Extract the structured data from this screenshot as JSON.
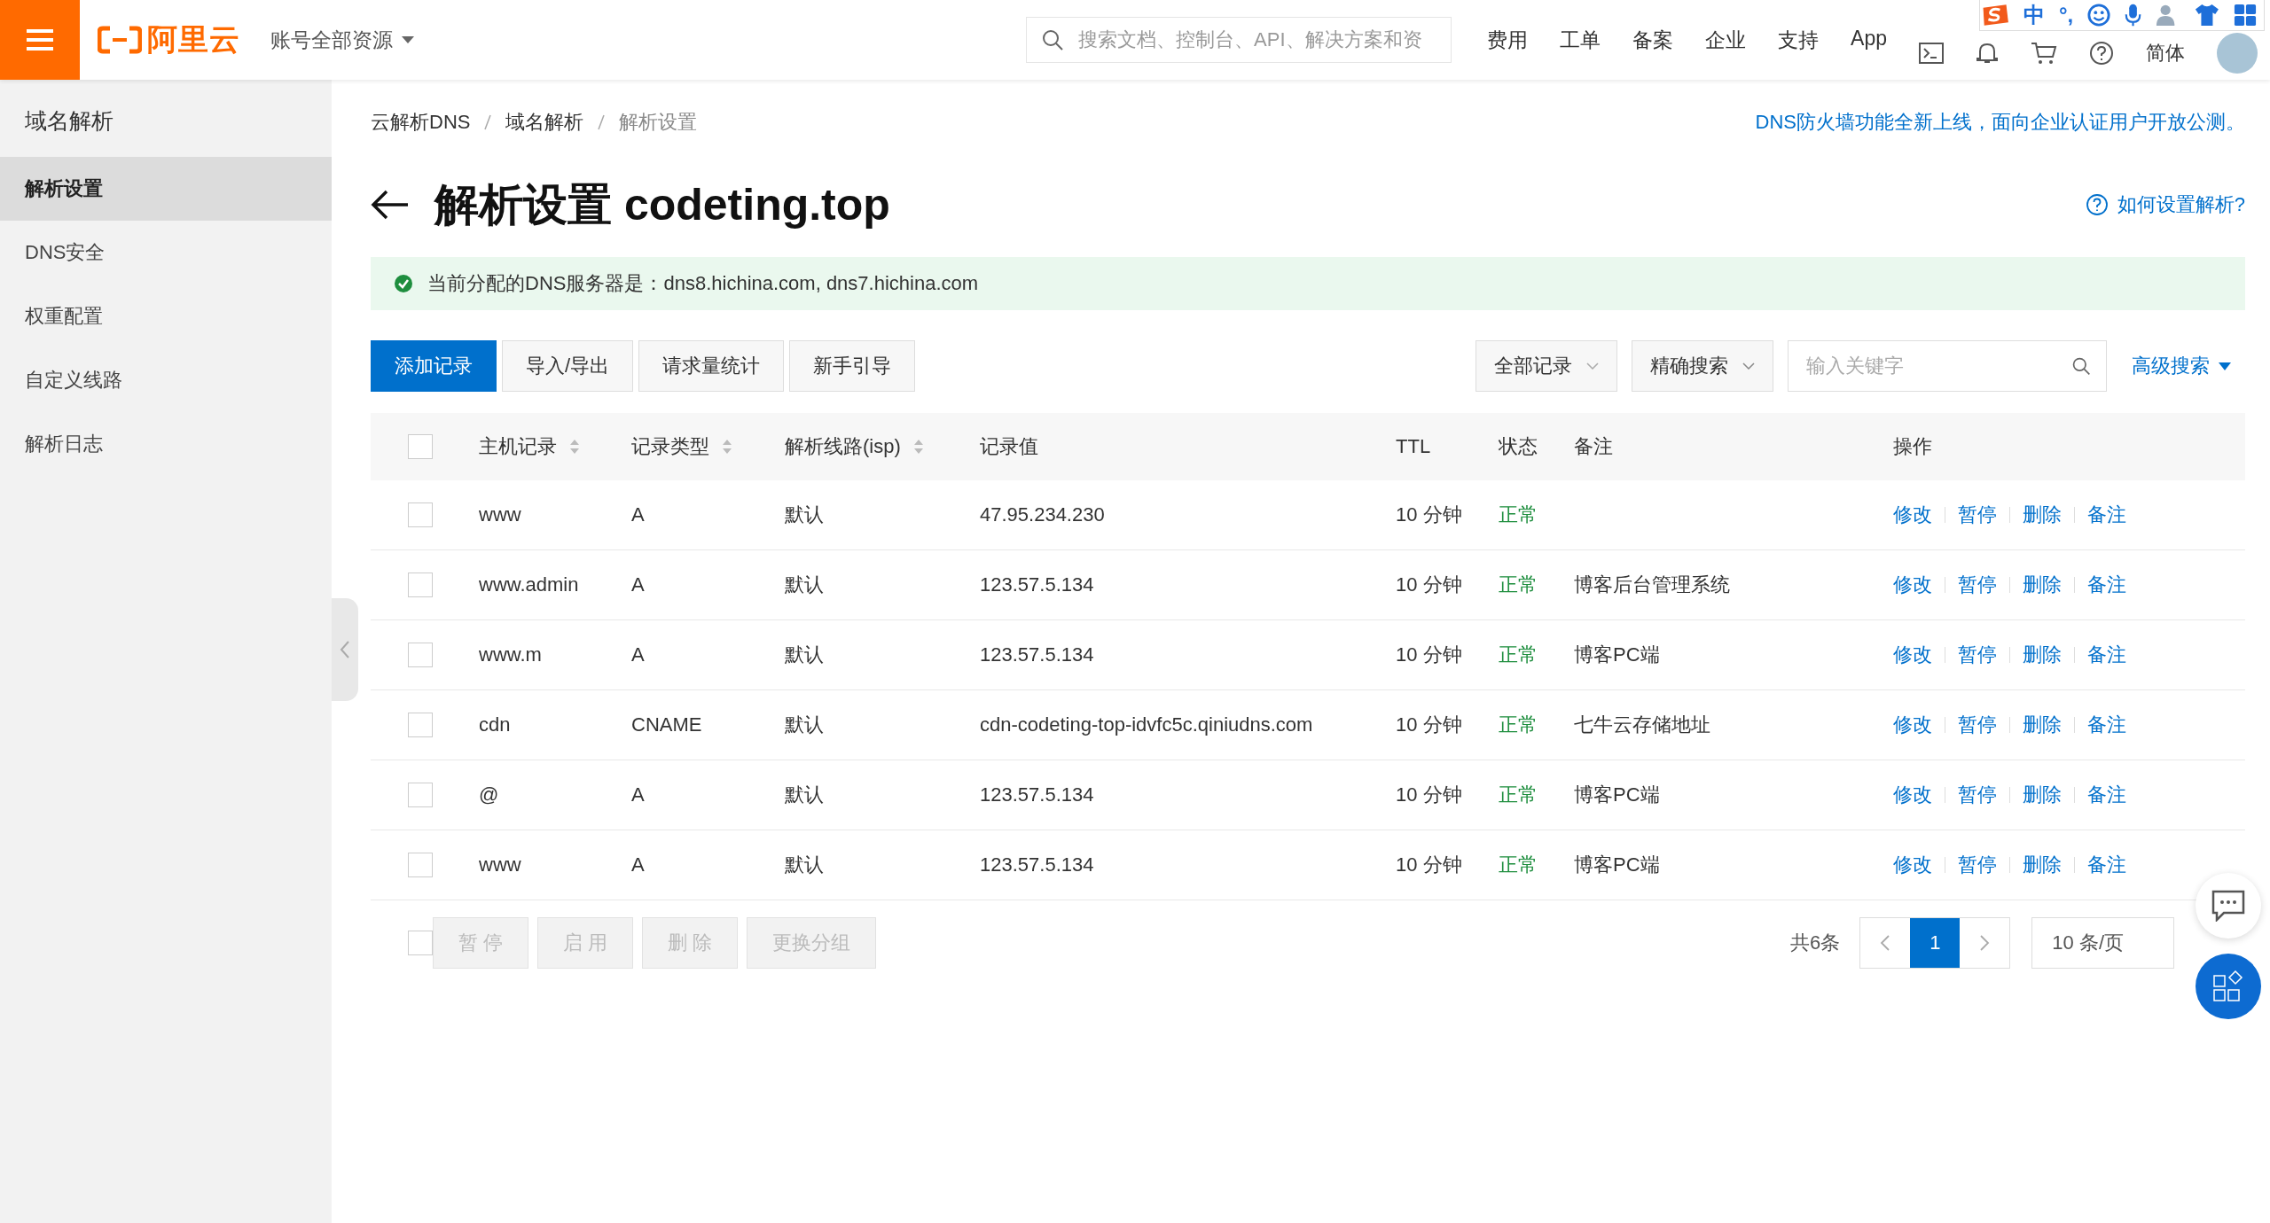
{
  "topbar": {
    "logo": "阿里云",
    "account_menu": "账号全部资源",
    "search": {
      "placeholder": "搜索文档、控制台、API、解决方案和资"
    },
    "nav": [
      "费用",
      "工单",
      "备案",
      "企业",
      "支持",
      "App"
    ],
    "language": "简体"
  },
  "ime_toolbar": {
    "mode": "中",
    "punctuation": "°,"
  },
  "sidebar": {
    "title": "域名解析",
    "items": [
      {
        "label": "解析设置",
        "selected": true
      },
      {
        "label": "DNS安全",
        "selected": false
      },
      {
        "label": "权重配置",
        "selected": false
      },
      {
        "label": "自定义线路",
        "selected": false
      },
      {
        "label": "解析日志",
        "selected": false
      }
    ]
  },
  "breadcrumb": [
    "云解析DNS",
    "域名解析",
    "解析设置"
  ],
  "notice_link": "DNS防火墙功能全新上线，面向企业认证用户开放公测。",
  "title": "解析设置 codeting.top",
  "help_link": "如何设置解析?",
  "alert": "当前分配的DNS服务器是：dns8.hichina.com, dns7.hichina.com",
  "toolbar": {
    "buttons": [
      {
        "label": "添加记录",
        "primary": true
      },
      {
        "label": "导入/导出",
        "primary": false
      },
      {
        "label": "请求量统计",
        "primary": false
      },
      {
        "label": "新手引导",
        "primary": false
      }
    ],
    "filter": "全部记录",
    "search_mode": "精确搜索",
    "search": {
      "placeholder": "输入关键字"
    },
    "advanced": "高级搜索"
  },
  "table": {
    "select_all": {
      "checked": false
    },
    "columns": [
      {
        "label": "主机记录",
        "sortable": true
      },
      {
        "label": "记录类型",
        "sortable": true
      },
      {
        "label": "解析线路(isp)",
        "sortable": true
      },
      {
        "label": "记录值",
        "sortable": false
      },
      {
        "label": "TTL",
        "sortable": false
      },
      {
        "label": "状态",
        "sortable": false
      },
      {
        "label": "备注",
        "sortable": false
      },
      {
        "label": "操作",
        "sortable": false
      }
    ],
    "rows": [
      {
        "checked": false,
        "host": "www",
        "type": "A",
        "line": "默认",
        "value": "47.95.234.230",
        "ttl": "10 分钟",
        "status": "正常",
        "remark": "",
        "actions": [
          "修改",
          "暂停",
          "删除",
          "备注"
        ]
      },
      {
        "checked": false,
        "host": "www.admin",
        "type": "A",
        "line": "默认",
        "value": "123.57.5.134",
        "ttl": "10 分钟",
        "status": "正常",
        "remark": "博客后台管理系统",
        "actions": [
          "修改",
          "暂停",
          "删除",
          "备注"
        ]
      },
      {
        "checked": false,
        "host": "www.m",
        "type": "A",
        "line": "默认",
        "value": "123.57.5.134",
        "ttl": "10 分钟",
        "status": "正常",
        "remark": "博客PC端",
        "actions": [
          "修改",
          "暂停",
          "删除",
          "备注"
        ]
      },
      {
        "checked": false,
        "host": "cdn",
        "type": "CNAME",
        "line": "默认",
        "value": "cdn-codeting-top-idvfc5c.qiniudns.com",
        "ttl": "10 分钟",
        "status": "正常",
        "remark": "七牛云存储地址",
        "actions": [
          "修改",
          "暂停",
          "删除",
          "备注"
        ]
      },
      {
        "checked": false,
        "host": "@",
        "type": "A",
        "line": "默认",
        "value": "123.57.5.134",
        "ttl": "10 分钟",
        "status": "正常",
        "remark": "博客PC端",
        "actions": [
          "修改",
          "暂停",
          "删除",
          "备注"
        ]
      },
      {
        "checked": false,
        "host": "www",
        "type": "A",
        "line": "默认",
        "value": "123.57.5.134",
        "ttl": "10 分钟",
        "status": "正常",
        "remark": "博客PC端",
        "actions": [
          "修改",
          "暂停",
          "删除",
          "备注"
        ]
      }
    ]
  },
  "footer": {
    "select": {
      "checked": false
    },
    "buttons": [
      {
        "label": "暂 停",
        "disabled": true
      },
      {
        "label": "启 用",
        "disabled": true
      },
      {
        "label": "删 除",
        "disabled": true
      },
      {
        "label": "更换分组",
        "disabled": true
      }
    ],
    "total": "共6条",
    "pages": [
      {
        "label": "1",
        "selected": true
      }
    ],
    "page_size": "10 条/页"
  }
}
